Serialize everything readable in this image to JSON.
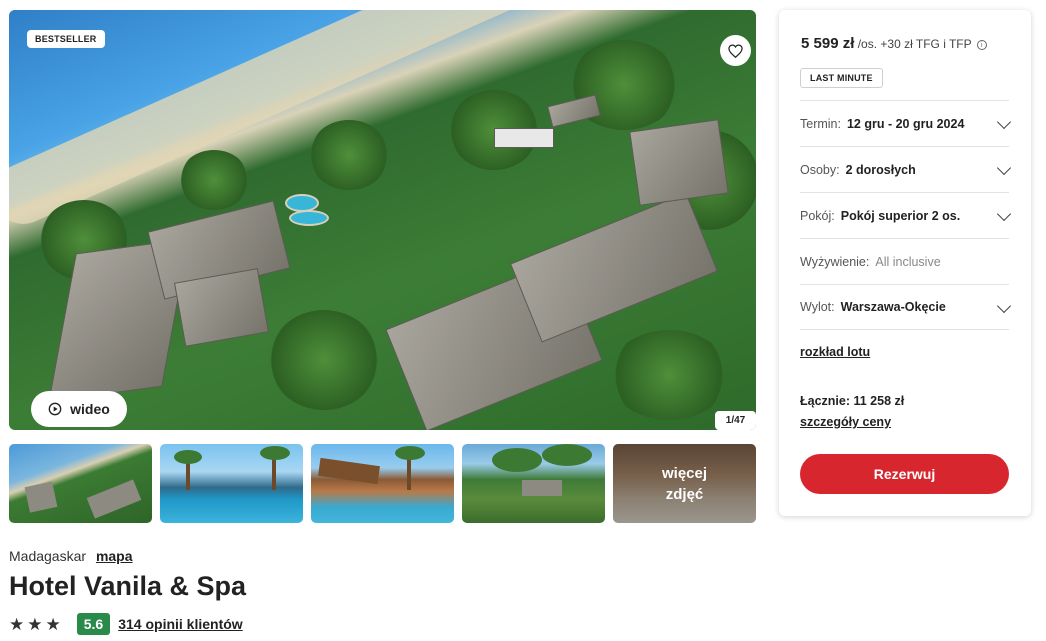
{
  "gallery": {
    "badge": "BESTSELLER",
    "video_label": "wideo",
    "counter": "1/47",
    "more_photos": "więcej zdjęć",
    "icons": {
      "favorite": "heart-icon",
      "play": "play-circle-icon"
    }
  },
  "booking": {
    "price": "5 599 zł",
    "price_suffix": "/os. +30 zł TFG i TFP",
    "tag": "LAST MINUTE",
    "rows": [
      {
        "label": "Termin:",
        "value": "12 gru - 20 gru 2024"
      },
      {
        "label": "Osoby:",
        "value": "2 dorosłych"
      },
      {
        "label": "Pokój:",
        "value": "Pokój superior 2 os."
      },
      {
        "label": "Wyżywienie:",
        "value": "All inclusive"
      },
      {
        "label": "Wylot:",
        "value": "Warszawa-Okęcie"
      }
    ],
    "schedule_link": "rozkład lotu",
    "total": "Łącznie: 11 258 zł",
    "price_details_link": "szczegóły ceny",
    "reserve_label": "Rezerwuj",
    "colors": {
      "reserve": "#d7262d",
      "score": "#2a8a4a"
    }
  },
  "hotel": {
    "location": "Madagaskar",
    "map_link": "mapa",
    "name": "Hotel Vanila & Spa",
    "stars": 3,
    "score": "5.6",
    "reviews_link": "314 opinii klientów"
  }
}
